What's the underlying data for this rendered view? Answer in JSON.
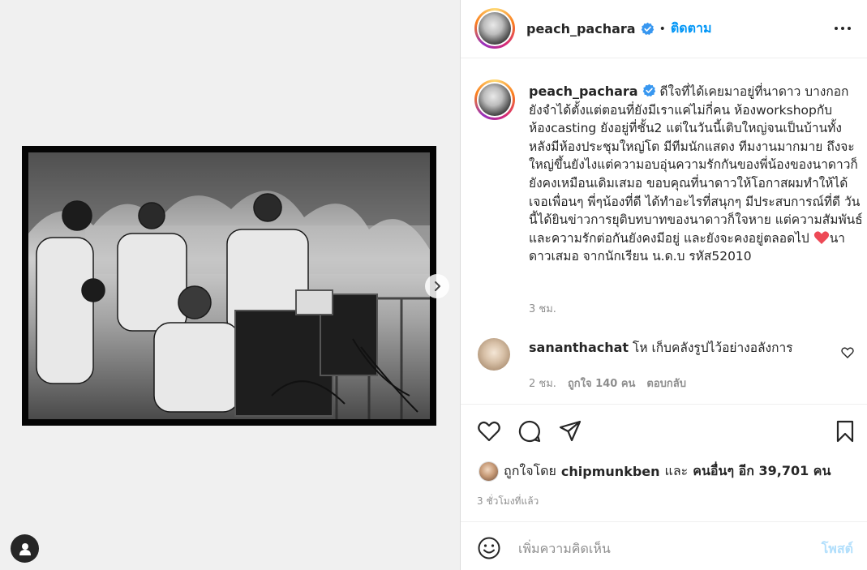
{
  "post": {
    "author": "peach_pachara",
    "dot": "•",
    "follow_label": "ติดตาม",
    "caption": "ดีใจที่ได้เคยมาอยู่ที่นาดาว บางกอก ยังจำได้ตั้งแต่ตอนที่ยังมีเราแค่ไม่กี่คน ห้องworkshopกับห้องcasting ยังอยู่ที่ชั้น2 แต่ในวันนี้เติบใหญ่จนเป็นบ้านทั้งหลังมีห้องประชุมใหญ่โต มีทีมนักแสดง ทีมงานมากมาย ถึงจะใหญ่ขึ้นยังไงแต่ความอบอุ่นความรักกันของพี่น้องของนาดาวก็ยังคงเหมือนเดิมเสมอ ขอบคุณที่นาดาวให้โอกาสผมทำให้ได้เจอเพื่อนๆ พี่ๆน้องที่ดี ได้ทำอะไรที่สนุกๆ มีประสบการณ์ที่ดี วันนี้ได้ยินข่าวการยุติบทบาทของนาดาวก็ใจหาย แต่ความสัมพันธ์และความรักต่อกันยังคงมีอยู่ และยังจะคงอยู่ตลอดไป ",
    "caption_end": "นาดาวเสมอ จากนักเรียน น.ด.บ รหัส52010",
    "caption_time": "3 ชม.",
    "heart_emoji": "❤️"
  },
  "comment": {
    "user": "sananthachat",
    "text": "โห เก็บคลังรูปไว้อย่างอลังการ",
    "time": "2 ชม.",
    "likes": "ถูกใจ 140 คน",
    "reply": "ตอบกลับ"
  },
  "likes": {
    "prefix": "ถูกใจโดย",
    "user": "chipmunkben",
    "and": "และ",
    "others": "คนอื่นๆ อีก 39,701 คน"
  },
  "posted_ago": "3 ชั่วโมงที่แล้ว",
  "comment_box": {
    "placeholder": "เพิ่มความคิดเห็น",
    "post_label": "โพสต์"
  },
  "colors": {
    "accent": "#0095f6",
    "verified": "#3897f0",
    "heart": "#ed4956"
  },
  "icons": {
    "more": "more-horizontal-icon",
    "like": "heart-outline-icon",
    "comment": "comment-bubble-icon",
    "share": "paper-plane-icon",
    "save": "bookmark-icon",
    "emoji": "smiley-icon",
    "next": "chevron-right-icon",
    "verified": "verified-badge-icon",
    "profile": "user-silhouette-icon"
  }
}
